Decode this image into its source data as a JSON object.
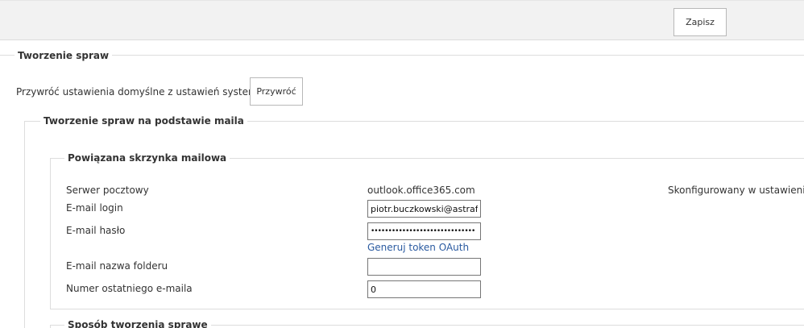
{
  "toolbar": {
    "save_label": "Zapisz"
  },
  "case_creation": {
    "title": "Tworzenie spraw",
    "restore_text": "Przywróć ustawienia domyślne z ustawień systemowych",
    "restore_label": "Przywróć",
    "from_email": {
      "title": "Tworzenie spraw na podstawie maila",
      "mailbox": {
        "title": "Powiązana skrzynka mailowa",
        "server_label": "Serwer pocztowy",
        "server_value": "outlook.office365.com",
        "server_note": "Skonfigurowany w ustawieniach s",
        "login_label": "E-mail login",
        "login_value": "piotr.buczkowski@astrafox",
        "password_label": "E-mail hasło",
        "password_value": "••••••••••••••••••••••••••••••",
        "oauth_link": "Generuj token OAuth",
        "folder_label": "E-mail nazwa folderu",
        "folder_value": "",
        "last_email_label": "Numer ostatniego e-maila",
        "last_email_value": "0"
      },
      "method": {
        "title": "Sposób tworzenia sprawe"
      }
    }
  }
}
